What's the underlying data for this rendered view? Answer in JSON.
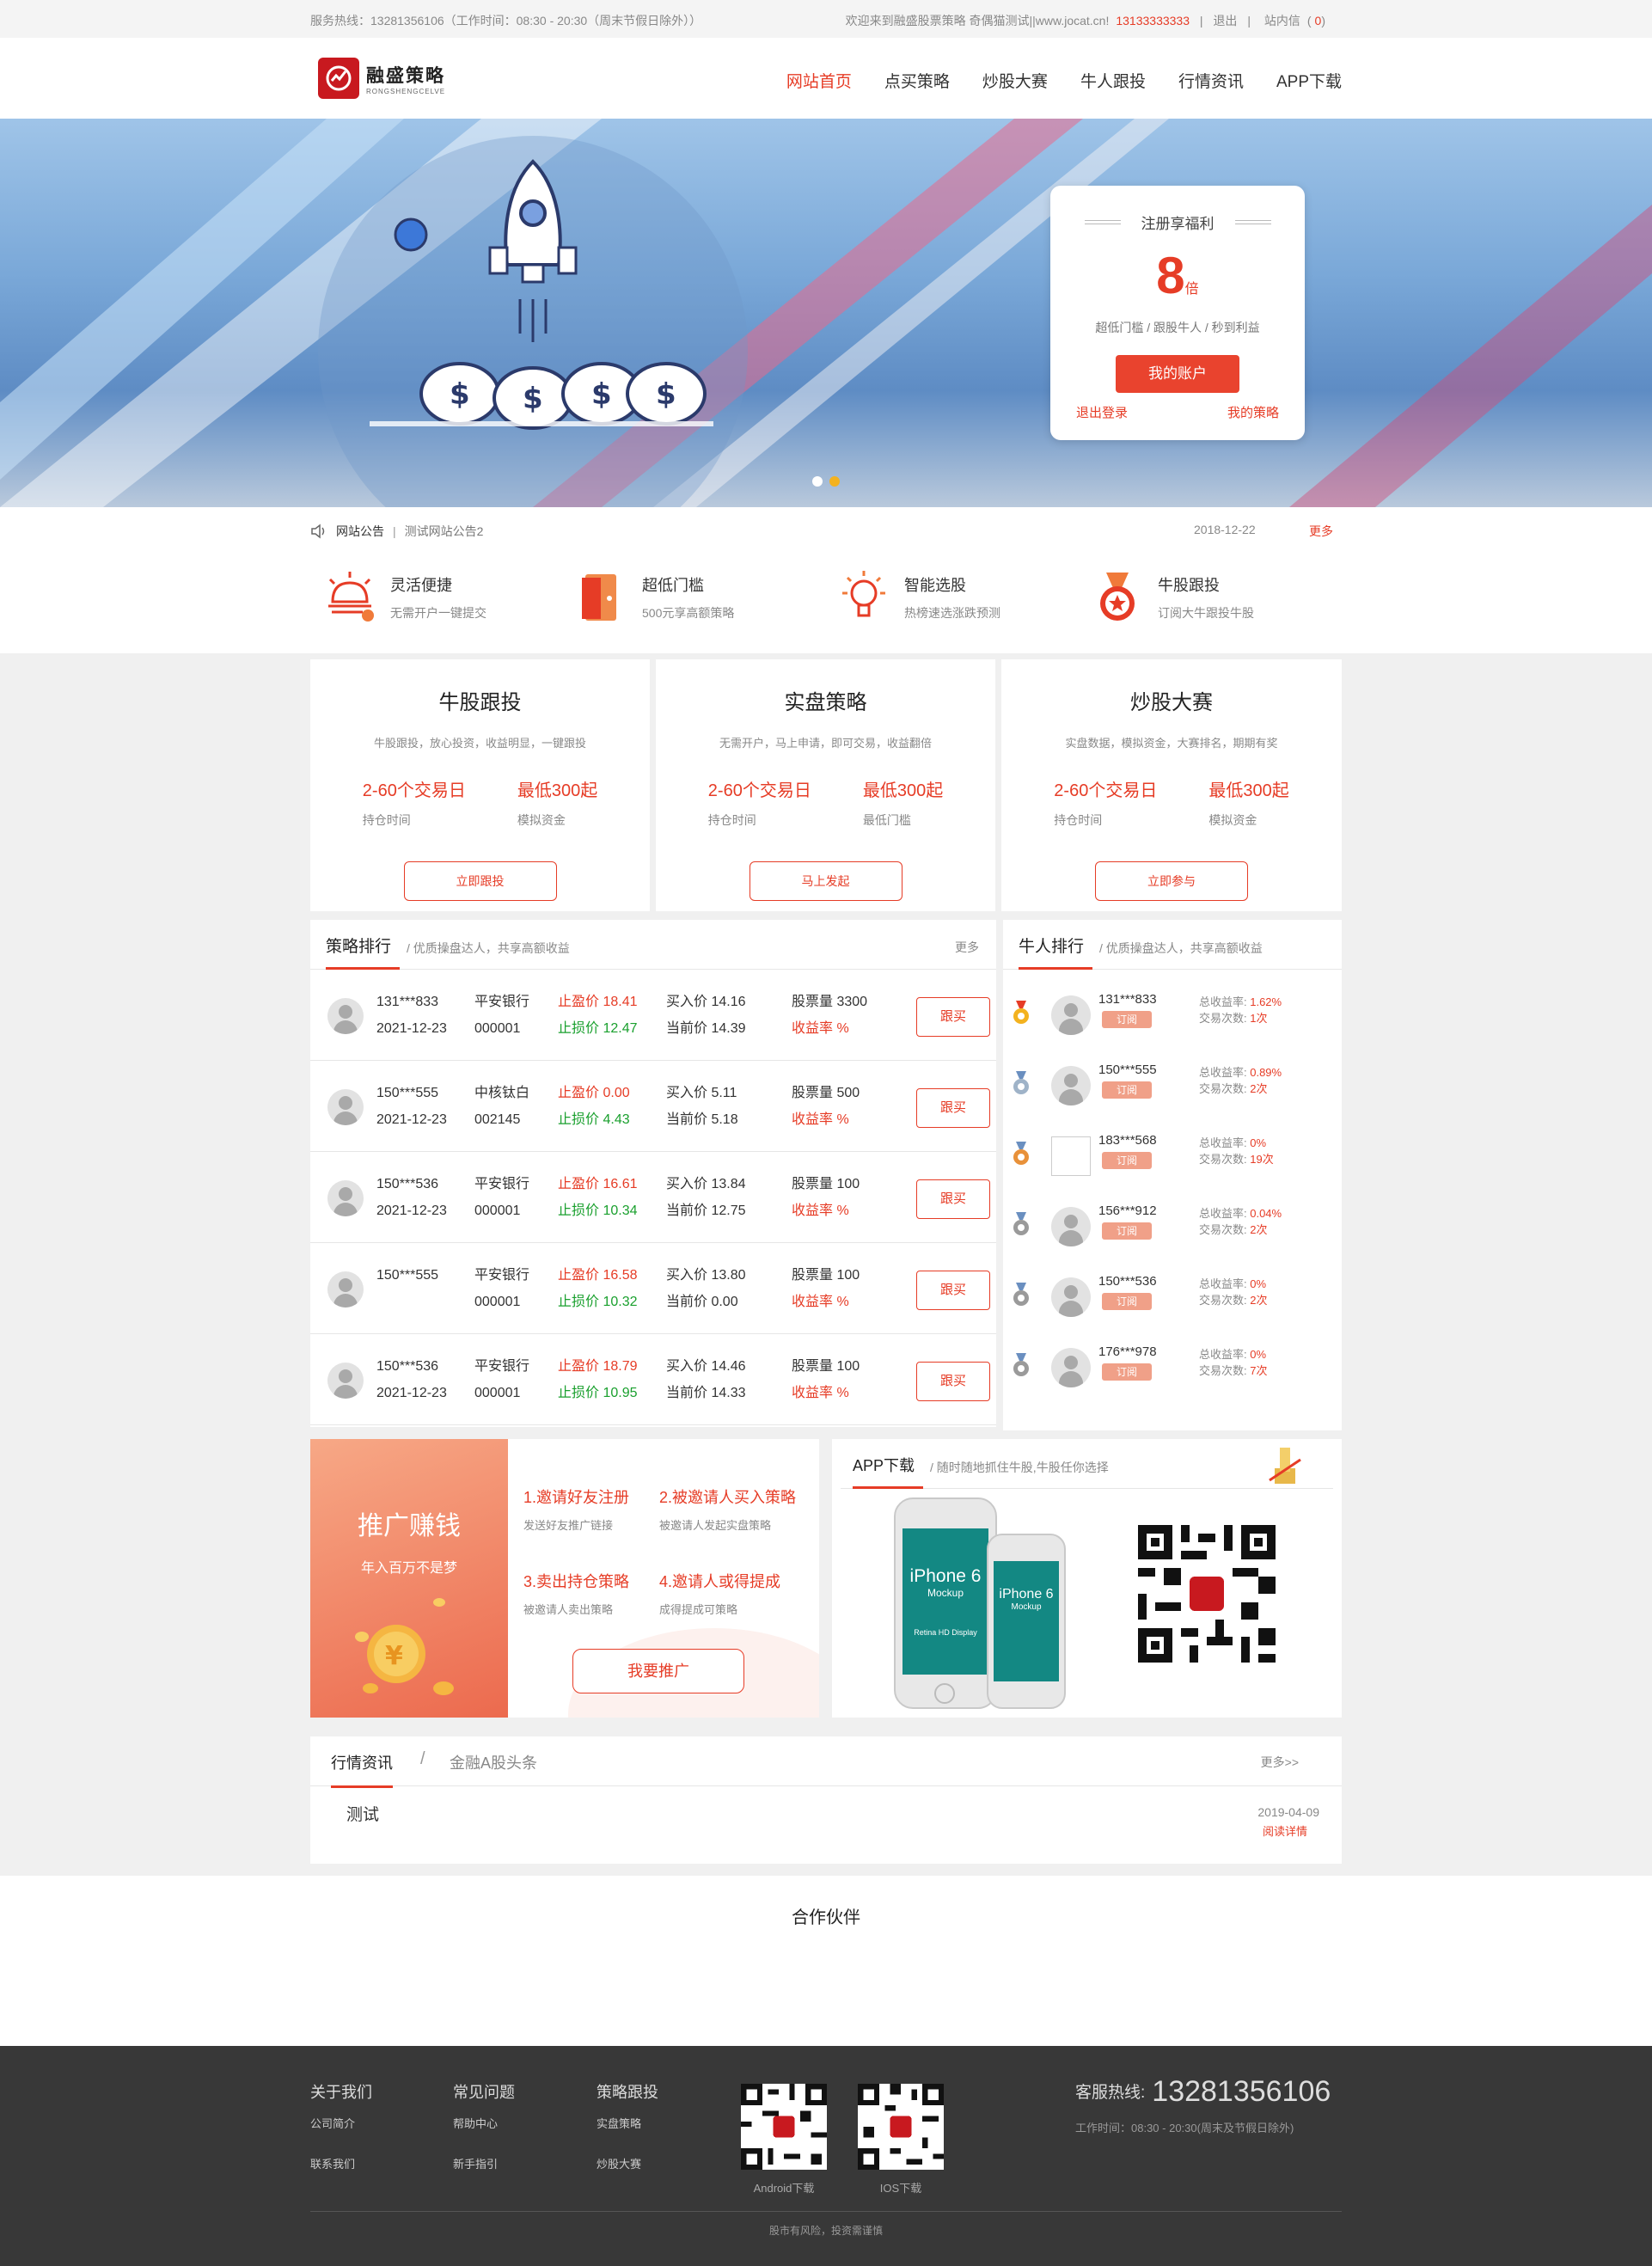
{
  "topbar": {
    "service": "服务热线：13281356106（工作时间：08:30 - 20:30（周末节假日除外））",
    "welcome": "欢迎来到融盛股票策略 奇偶猫测试||www.jocat.cn!",
    "phone": "13133333333",
    "logout": "退出",
    "inbox": "站内信",
    "inbox_count_open": "(",
    "inbox_count": "0",
    "inbox_count_close": ")",
    "sep": "|"
  },
  "header": {
    "logo_cn": "融盛策略",
    "logo_en": "RONGSHENGCELVE",
    "nav": [
      "网站首页",
      "点买策略",
      "炒股大赛",
      "牛人跟投",
      "行情资讯",
      "APP下载"
    ]
  },
  "banner": {
    "card_title": "注册享福利",
    "multiplier": "8",
    "multiplier_unit": "倍",
    "desc": "超低门槛 / 跟股牛人 / 秒到利益",
    "account_button": "我的账户",
    "logout_link": "退出登录",
    "strategy_link": "我的策略"
  },
  "notice": {
    "label": "网站公告",
    "sep": "|",
    "message": "测试网站公告2",
    "date": "2018-12-22",
    "more": "更多"
  },
  "features": [
    {
      "title": "灵活便捷",
      "desc": "无需开户一键提交"
    },
    {
      "title": "超低门槛",
      "desc": "500元享高额策略"
    },
    {
      "title": "智能选股",
      "desc": "热榜速选涨跌预测"
    },
    {
      "title": "牛股跟投",
      "desc": "订阅大牛跟投牛股"
    }
  ],
  "products": [
    {
      "title": "牛股跟投",
      "desc": "牛股跟投，放心投资，收益明显，一键跟投",
      "v1": "2-60个交易日",
      "l1": "持仓时间",
      "v2": "最低300起",
      "l2": "模拟资金",
      "button": "立即跟投"
    },
    {
      "title": "实盘策略",
      "desc": "无需开户，马上申请，即可交易，收益翻倍",
      "v1": "2-60个交易日",
      "l1": "持仓时间",
      "v2": "最低300起",
      "l2": "最低门槛",
      "button": "马上发起"
    },
    {
      "title": "炒股大赛",
      "desc": "实盘数据，模拟资金，大赛排名，期期有奖",
      "v1": "2-60个交易日",
      "l1": "持仓时间",
      "v2": "最低300起",
      "l2": "模拟资金",
      "button": "立即参与"
    }
  ],
  "strategy": {
    "title": "策略排行",
    "subtitle": "/ 优质操盘达人，共享高额收益",
    "more": "更多",
    "rows": [
      {
        "user": "131***833",
        "date": "2021-12-23",
        "stock": "平安银行",
        "code": "000001",
        "tp_label": "止盈价",
        "tp": "18.41",
        "sl_label": "止损价",
        "sl": "12.47",
        "buy": "买入价 14.16",
        "cur": "当前价 14.39",
        "qty": "股票量 3300",
        "yield": "收益率 %",
        "btn": "跟买"
      },
      {
        "user": "150***555",
        "date": "2021-12-23",
        "stock": "中核钛白",
        "code": "002145",
        "tp_label": "止盈价",
        "tp": "0.00",
        "sl_label": "止损价",
        "sl": "4.43",
        "buy": "买入价 5.11",
        "cur": "当前价 5.18",
        "qty": "股票量 500",
        "yield": "收益率 %",
        "btn": "跟买"
      },
      {
        "user": "150***536",
        "date": "2021-12-23",
        "stock": "平安银行",
        "code": "000001",
        "tp_label": "止盈价",
        "tp": "16.61",
        "sl_label": "止损价",
        "sl": "10.34",
        "buy": "买入价 13.84",
        "cur": "当前价 12.75",
        "qty": "股票量 100",
        "yield": "收益率 %",
        "btn": "跟买"
      },
      {
        "user": "150***555",
        "date": "",
        "stock": "平安银行",
        "code": "000001",
        "tp_label": "止盈价",
        "tp": "16.58",
        "sl_label": "止损价",
        "sl": "10.32",
        "buy": "买入价 13.80",
        "cur": "当前价 0.00",
        "qty": "股票量 100",
        "yield": "收益率 %",
        "btn": "跟买"
      },
      {
        "user": "150***536",
        "date": "2021-12-23",
        "stock": "平安银行",
        "code": "000001",
        "tp_label": "止盈价",
        "tp": "18.79",
        "sl_label": "止损价",
        "sl": "10.95",
        "buy": "买入价 14.46",
        "cur": "当前价 14.33",
        "qty": "股票量 100",
        "yield": "收益率 %",
        "btn": "跟买"
      }
    ]
  },
  "bulls": {
    "title": "牛人排行",
    "subtitle": "/ 优质操盘达人，共享高额收益",
    "subscribe": "订阅",
    "yield_label": "总收益率: ",
    "trades_label": "交易次数: ",
    "rows": [
      {
        "user": "131***833",
        "yield": "1.62%",
        "trades": "1次",
        "medal": "gold"
      },
      {
        "user": "150***555",
        "yield": "0.89%",
        "trades": "2次",
        "medal": "silver"
      },
      {
        "user": "183***568",
        "yield": "0%",
        "trades": "19次",
        "medal": "bronze"
      },
      {
        "user": "156***912",
        "yield": "0.04%",
        "trades": "2次",
        "medal": "gray"
      },
      {
        "user": "150***536",
        "yield": "0%",
        "trades": "2次",
        "medal": "gray"
      },
      {
        "user": "176***978",
        "yield": "0%",
        "trades": "7次",
        "medal": "gray"
      }
    ]
  },
  "promo": {
    "title": "推广赚钱",
    "subtitle": "年入百万不是梦",
    "items": [
      {
        "a": "1.邀请好友注册",
        "b": "发送好友推广链接"
      },
      {
        "a": "2.被邀请人买入策略",
        "b": "被邀请人发起实盘策略"
      },
      {
        "a": "3.卖出持仓策略",
        "b": "被邀请人卖出策略"
      },
      {
        "a": "4.邀请人或得提成",
        "b": "成得提成可策略"
      }
    ],
    "button": "我要推广"
  },
  "app": {
    "title": "APP下载",
    "subtitle": "/ 随时随地抓住牛股,牛股任你选择",
    "phone1_title": "iPhone 6",
    "phone1_sub": "Mockup",
    "phone2_title": "iPhone 6",
    "phone2_sub": "Mockup",
    "display_name": "Retina HD Display"
  },
  "news": {
    "tab1": "行情资讯",
    "slash": "/",
    "tab2": "金融A股头条",
    "more": "更多>>",
    "items": [
      {
        "title": "测试",
        "date": "2019-04-09",
        "link": "阅读详情"
      }
    ]
  },
  "partner": {
    "title": "合作伙伴"
  },
  "footer": {
    "cols": [
      {
        "h": "关于我们",
        "i1": "公司简介",
        "i2": "联系我们"
      },
      {
        "h": "常见问题",
        "i1": "帮助中心",
        "i2": "新手指引"
      },
      {
        "h": "策略跟投",
        "i1": "实盘策略",
        "i2": "炒股大赛"
      }
    ],
    "android": "Android下载",
    "ios": "IOS下载",
    "hotline_label": "客服热线:",
    "hotline": "13281356106",
    "hours": "工作时间：08:30 - 20:30(周末及节假日除外)",
    "copyright": "股市有风险，投资需谨慎"
  },
  "colors": {
    "accent": "#e63c26",
    "green": "#1aa02e",
    "footer_bg": "#383838"
  }
}
